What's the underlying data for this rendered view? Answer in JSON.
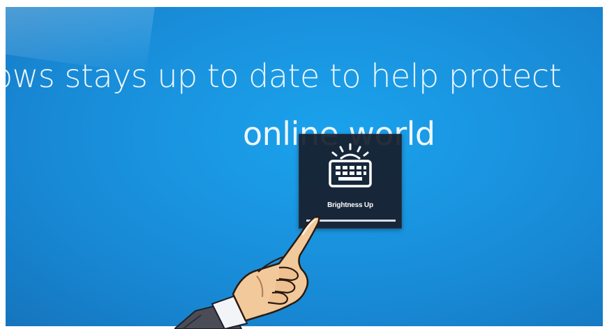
{
  "screen": {
    "headline": "ows stays up to date to help protect",
    "subline": "online world",
    "background_color": "#1a95e0"
  },
  "osd": {
    "label": "Brightness Up",
    "icon": "keyboard-backlight-icon",
    "level": 1.0
  },
  "overlay": {
    "icon": "pointing-hand-icon"
  }
}
